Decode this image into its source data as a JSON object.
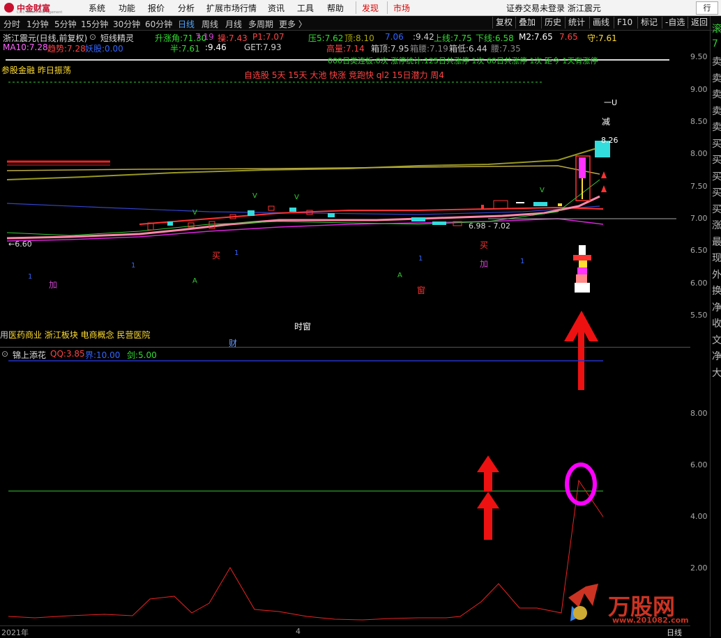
{
  "menubar": {
    "logo_text": "中金财富",
    "logo_sub": "CICC Wealth Management",
    "items": [
      "系统",
      "功能",
      "报价",
      "分析",
      "扩展市场行情",
      "资讯",
      "工具",
      "帮助"
    ],
    "discover": "发现",
    "market": "市场",
    "login_status": "证券交易未登录  浙江震元",
    "window_btn": "行"
  },
  "periods": {
    "items": [
      "分时",
      "1分钟",
      "5分钟",
      "15分钟",
      "30分钟",
      "60分钟",
      "日线",
      "周线",
      "月线",
      "多周期",
      "更多 〉"
    ],
    "active": "日线"
  },
  "toolbar": {
    "buttons": [
      "复权",
      "叠加",
      "历史",
      "统计",
      "画线",
      "F10",
      "标记",
      "-自选",
      "返回"
    ]
  },
  "main_header": {
    "stock": "浙江震元(日线,前复权)",
    "indicator": "短线精灵",
    "row1": [
      {
        "label": "升涨角:",
        "value": "71.30",
        "color": "#33dd33"
      },
      {
        "label": "",
        "value": "7.19",
        "color": "#cc44cc"
      },
      {
        "label": "操:",
        "value": "7.43",
        "color": "#ff4444"
      },
      {
        "label": "P1:",
        "value": "7.07",
        "color": "#ff4444"
      },
      {
        "label": "压5:",
        "value": "7.62",
        "color": "#33dd33"
      },
      {
        "label": "顶:",
        "value": "8.10",
        "color": "#aaaa00"
      },
      {
        "label": "",
        "value": "7.06",
        "color": "#3366ff"
      },
      {
        "label": ":",
        "value": "9.42",
        "color": "#cfcfcf"
      },
      {
        "label": "上线:",
        "value": "7.75",
        "color": "#33dd33"
      },
      {
        "label": "下线:",
        "value": "6.58",
        "color": "#33dd33"
      },
      {
        "label": "M2:",
        "value": "7.65",
        "color": "#ffffff"
      },
      {
        "label": "",
        "value": "7.65",
        "color": "#ff4444"
      },
      {
        "label": "守:",
        "value": "7.61",
        "color": "#ffdd33"
      }
    ],
    "row2": [
      {
        "label": "MA10:",
        "value": "7.28",
        "color": "#ff66ff"
      },
      {
        "label": "趋势:",
        "value": "7.28",
        "color": "#ff4444"
      },
      {
        "label": "妖股:",
        "value": "0.00",
        "color": "#3366ff"
      },
      {
        "label": "半:",
        "value": "7.61",
        "color": "#33dd33"
      },
      {
        "label": ":",
        "value": "9.46",
        "color": "#ffffff"
      },
      {
        "label": "GET:",
        "value": "7.93",
        "color": "#cfcfcf"
      },
      {
        "label": "高量:",
        "value": "7.14",
        "color": "#ff4444"
      },
      {
        "label": "箱顶:",
        "value": "7.95",
        "color": "#cfcfcf"
      },
      {
        "label": "箱腰:",
        "value": "7.19",
        "color": "#888888"
      },
      {
        "label": "箱低:",
        "value": "6.44",
        "color": "#cfcfcf"
      },
      {
        "label": "腰:",
        "value": "7.35",
        "color": "#888888"
      }
    ]
  },
  "overlay_texts": {
    "concept_line": "参股金融  昨日振荡",
    "stats_line": "000日类连板:0次     涨停统计:125日共涨停 1次     60日共涨停 1次     距今 1天有涨停",
    "watch_line": "自选股  5天  15天  大池  快涨  竞跑快  ql2  15日潜力  周4",
    "sector_line": "医药商业 浙江板块 电商概念 民营医院",
    "sector_prefix": "用",
    "low_label": "6.60",
    "range_label": "6.98 - 7.02",
    "high_label": "8.26",
    "jian": "减",
    "u_mark": "一U",
    "shi_chuang": "时窗",
    "cai": "财",
    "markers": [
      {
        "text": "买",
        "color": "#ff3333"
      },
      {
        "text": "买",
        "color": "#ff3333"
      },
      {
        "text": "加",
        "color": "#cc44cc"
      },
      {
        "text": "加",
        "color": "#cc44cc"
      },
      {
        "text": "窗",
        "color": "#ff3333"
      }
    ]
  },
  "sub_header": {
    "name": "锦上添花",
    "values": [
      {
        "label": "QQ:",
        "value": "3.85",
        "color": "#ff4444"
      },
      {
        "label": "界:",
        "value": "10.00",
        "color": "#3366ff"
      },
      {
        "label": "剑:",
        "value": "5.00",
        "color": "#33dd33"
      }
    ]
  },
  "price_axis": [
    "9.50",
    "9.00",
    "8.50",
    "8.00",
    "7.50",
    "7.00",
    "6.50",
    "6.00",
    "5.50"
  ],
  "sub_axis": [
    "8.00",
    "6.00",
    "4.00",
    "2.00"
  ],
  "bottom_axis": {
    "year": "2021年",
    "month": "4",
    "mode": "日线"
  },
  "right_panel": {
    "chars": [
      "滚",
      "7",
      "卖",
      "卖",
      "卖",
      "卖",
      "卖",
      "买",
      "买",
      "买",
      "买",
      "买",
      "涨",
      "最",
      "现",
      "外",
      "换",
      "净",
      "收",
      "文",
      "净",
      "大"
    ]
  },
  "watermark": {
    "brand": "万股网",
    "url": "www.201082.com"
  },
  "colors": {
    "bg": "#000000",
    "up": "#ff3333",
    "down": "#33dddd",
    "accent": "#ff00ff",
    "ma_olive": "#999922"
  }
}
